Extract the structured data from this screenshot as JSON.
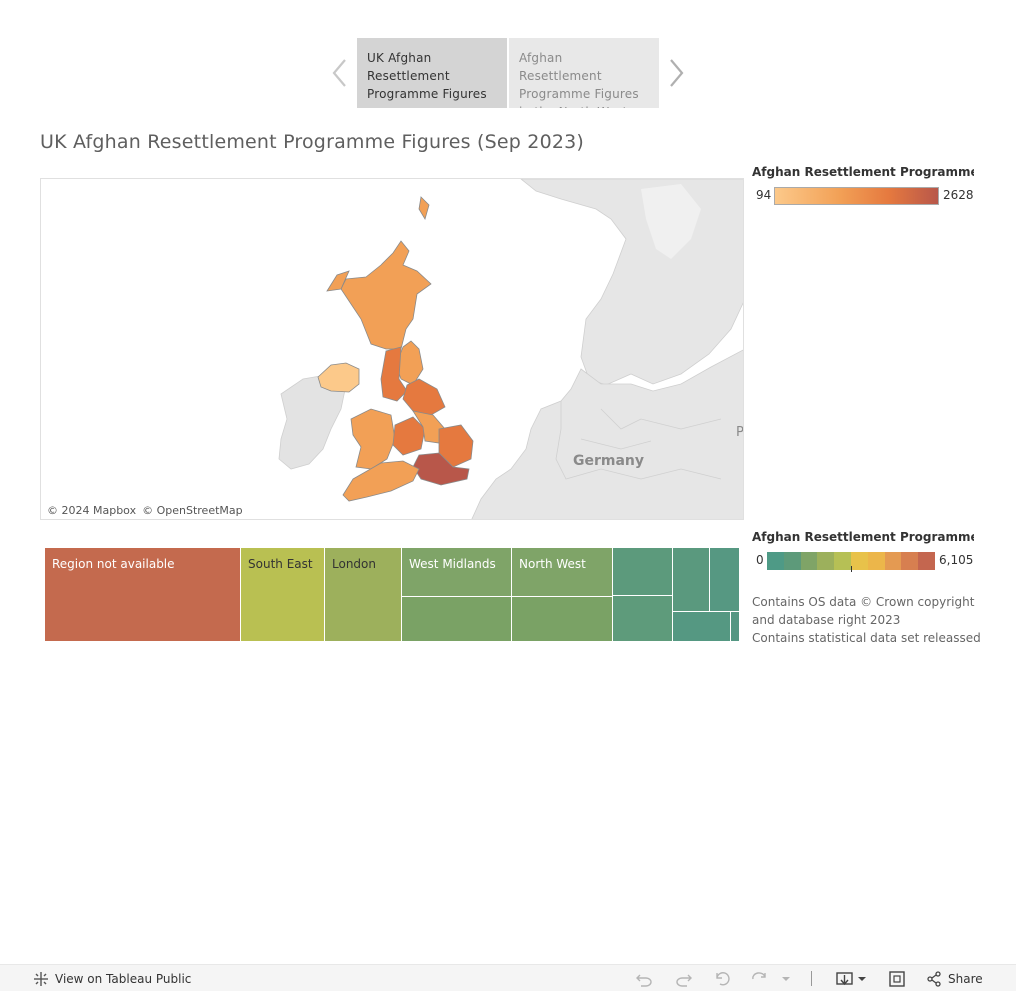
{
  "story": {
    "points": [
      {
        "label": "UK Afghan Resettlement Programme Figures",
        "active": true
      },
      {
        "label": "Afghan Resettlement Programme Figures in the North West",
        "active": false
      }
    ]
  },
  "dashboard": {
    "title": "UK Afghan Resettlement Programme Figures (Sep 2023)"
  },
  "map": {
    "credits": [
      "© 2024 Mapbox",
      "© OpenStreetMap"
    ],
    "labels": {
      "country": "Germany",
      "edge": "P"
    }
  },
  "legend_map": {
    "title": "Afghan Resettlement Programme (p...",
    "min": "94",
    "max": "2628",
    "colors": [
      "#fcc98a",
      "#f2a056",
      "#e5793f",
      "#b8574a"
    ]
  },
  "legend_treemap": {
    "title": "Afghan Resettlement Programme (p...",
    "min": "0",
    "max": "6,105",
    "colors": [
      "#4e9a86",
      "#5d9a7a",
      "#7fa467",
      "#9cb05c",
      "#b6c055",
      "#e8c24a",
      "#ecb64a",
      "#e49a52",
      "#d77f50",
      "#c4664f"
    ]
  },
  "footnote": {
    "lines": [
      "Contains OS data © Crown copyright and database right 2023",
      "Contains statistical data set releassed"
    ]
  },
  "treemap": {
    "cells": [
      {
        "label": "Region not available",
        "color": "#c46a4e",
        "text_color": "#ffffff"
      },
      {
        "label": "South East",
        "color": "#b9c052",
        "text_color": "#333333"
      },
      {
        "label": "London",
        "color": "#9db05c",
        "text_color": "#333333"
      },
      {
        "label": "West Midlands",
        "color": "#7fa468",
        "text_color": "#ffffff"
      },
      {
        "label": "North West",
        "color": "#7fa468",
        "text_color": "#ffffff"
      },
      {
        "label": "",
        "color": "#7aa265",
        "text_color": "#ffffff"
      },
      {
        "label": "",
        "color": "#7aa265",
        "text_color": "#ffffff"
      },
      {
        "label": "",
        "color": "#5c9a7c",
        "text_color": "#ffffff"
      },
      {
        "label": "",
        "color": "#5e9b7b",
        "text_color": "#ffffff"
      },
      {
        "label": "",
        "color": "#5a997e",
        "text_color": "#ffffff"
      },
      {
        "label": "",
        "color": "#569882",
        "text_color": "#ffffff"
      },
      {
        "label": "",
        "color": "#559882",
        "text_color": "#ffffff"
      },
      {
        "label": "",
        "color": "#549783",
        "text_color": "#ffffff"
      }
    ]
  },
  "toolbar": {
    "view_label": "View on Tableau Public",
    "share_label": "Share",
    "icons": [
      "tableau-logo-icon",
      "undo-icon",
      "redo-icon",
      "revert-icon",
      "refresh-icon",
      "pause-dropdown-icon",
      "download-icon",
      "fullscreen-icon",
      "share-icon"
    ]
  }
}
